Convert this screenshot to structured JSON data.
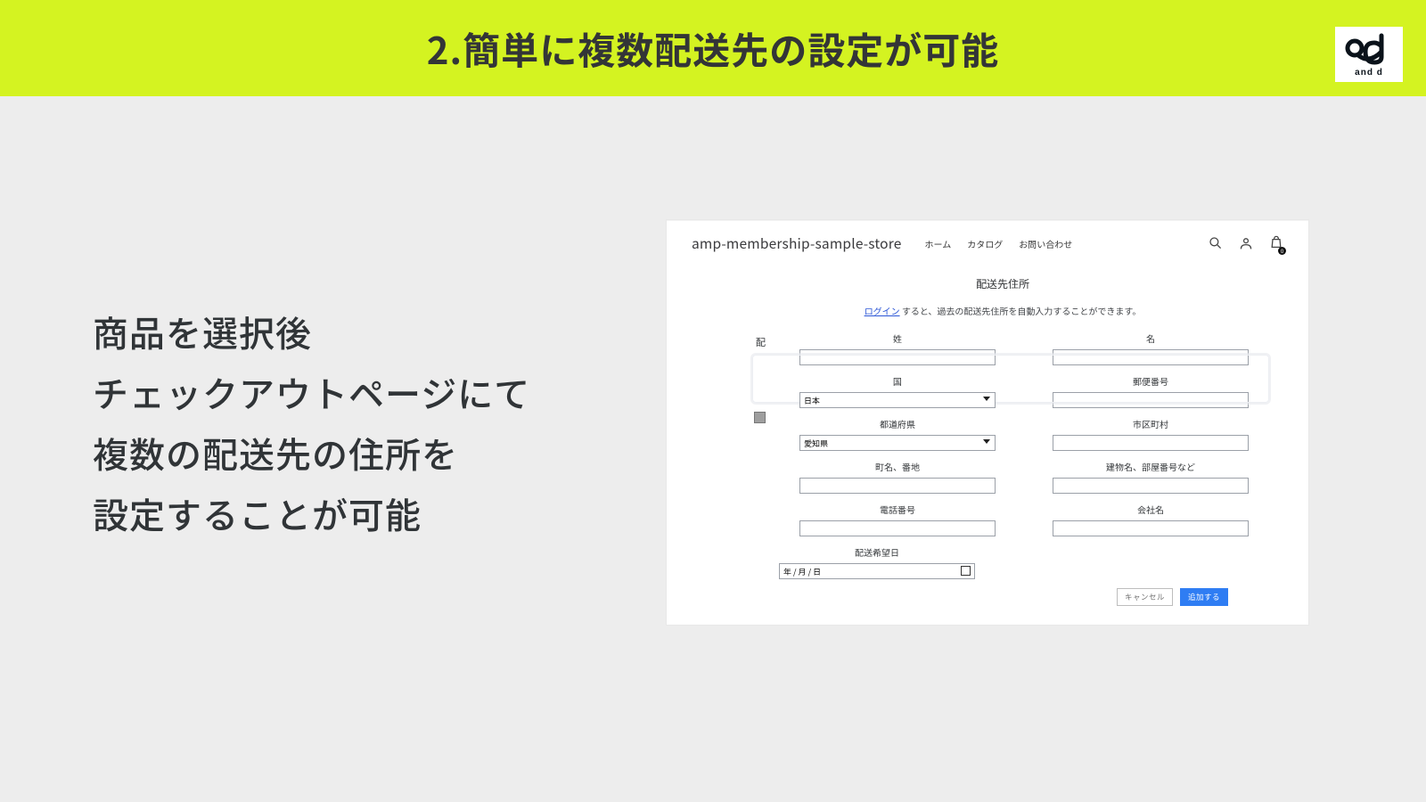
{
  "slide": {
    "title": "2.簡単に複数配送先の設定が可能",
    "logo_caption": "and d"
  },
  "description": {
    "line1": "商品を選択後",
    "line2": "チェックアウトページにて",
    "line3": "複数の配送先の住所を",
    "line4": "設定することが可能"
  },
  "shop": {
    "name": "amp-membership-sample-store",
    "nav": {
      "home": "ホーム",
      "catalog": "カタログ",
      "contact": "お問い合わせ"
    },
    "cart_badge": "0"
  },
  "form": {
    "left_hint": "配",
    "title": "配送先住所",
    "login_link": "ログイン",
    "login_tail": " すると、過去の配送先住所を自動入力することができます。",
    "labels": {
      "lastname": "姓",
      "firstname": "名",
      "country": "国",
      "postal": "郵便番号",
      "prefecture": "都道府県",
      "city": "市区町村",
      "street": "町名、番地",
      "building": "建物名、部屋番号など",
      "phone": "電話番号",
      "company": "会社名",
      "date": "配送希望日"
    },
    "values": {
      "country": "日本",
      "prefecture": "愛知県",
      "date_placeholder": "年 / 月 / 日"
    },
    "buttons": {
      "cancel": "キャンセル",
      "add": "追加する"
    }
  }
}
